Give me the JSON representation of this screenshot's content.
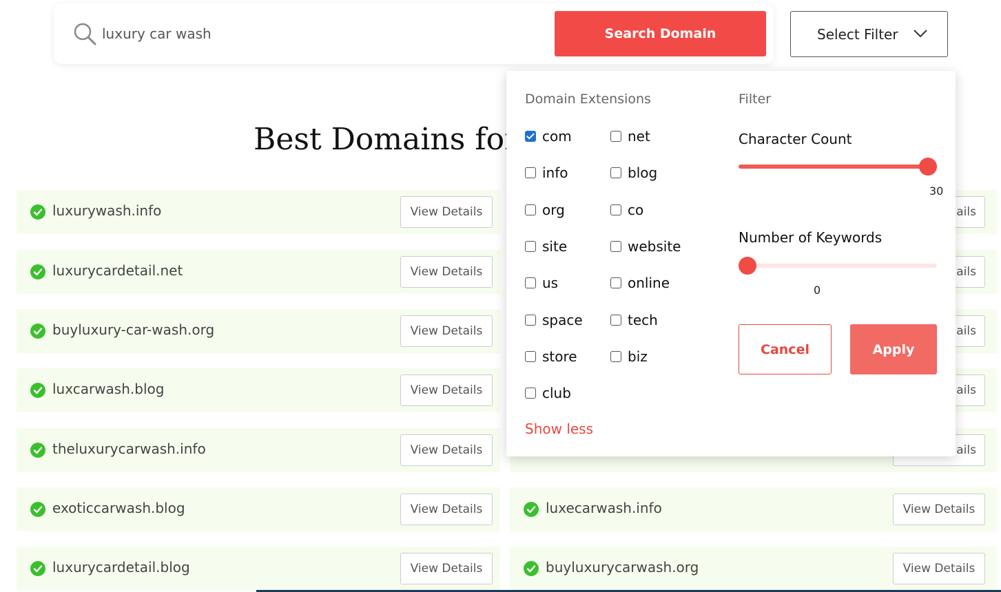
{
  "search": {
    "value": "luxury car wash",
    "button_label": "Search Domain"
  },
  "filter_button": {
    "label": "Select Filter"
  },
  "heading": "Best Domains for",
  "domains_left": [
    {
      "name": "luxurywash.info",
      "action": "View Details"
    },
    {
      "name": "luxurycardetail.net",
      "action": "View Details"
    },
    {
      "name": "buyluxury-car-wash.org",
      "action": "View Details"
    },
    {
      "name": "luxcarwash.blog",
      "action": "View Details"
    },
    {
      "name": "theluxurycarwash.info",
      "action": "View Details"
    },
    {
      "name": "exoticcarwash.blog",
      "action": "View Details"
    },
    {
      "name": "luxurycardetail.blog",
      "action": "View Details"
    }
  ],
  "domains_right": [
    {
      "name": "luxecarwash.info",
      "action": "View Details"
    },
    {
      "name": "buyluxurycarwash.org",
      "action": "View Details"
    }
  ],
  "right_partial_label": "ails",
  "panel": {
    "extensions_title": "Domain Extensions",
    "filter_title": "Filter",
    "extensions": [
      {
        "label": "com",
        "checked": true
      },
      {
        "label": "net",
        "checked": false
      },
      {
        "label": "info",
        "checked": false
      },
      {
        "label": "blog",
        "checked": false
      },
      {
        "label": "org",
        "checked": false
      },
      {
        "label": "co",
        "checked": false
      },
      {
        "label": "site",
        "checked": false
      },
      {
        "label": "website",
        "checked": false
      },
      {
        "label": "us",
        "checked": false
      },
      {
        "label": "online",
        "checked": false
      },
      {
        "label": "space",
        "checked": false
      },
      {
        "label": "tech",
        "checked": false
      },
      {
        "label": "store",
        "checked": false
      },
      {
        "label": "biz",
        "checked": false
      },
      {
        "label": "club",
        "checked": false
      }
    ],
    "show_less": "Show less",
    "character_count": {
      "label": "Character Count",
      "value": "30",
      "fraction": 1.0
    },
    "keywords": {
      "label": "Number of Keywords",
      "value": "0",
      "fraction": 0.0
    },
    "cancel_label": "Cancel",
    "apply_label": "Apply"
  },
  "colors": {
    "accent": "#f24b47",
    "row_bg": "#f6fdee",
    "check_green": "#3cbf2e"
  }
}
